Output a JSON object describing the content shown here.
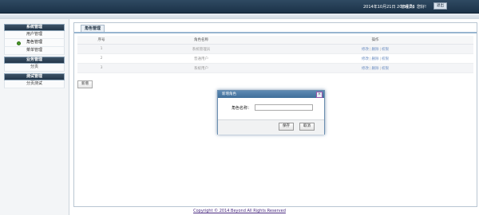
{
  "header": {
    "datetime": "2014年10月21日 20:54:28",
    "user": "管理员，您好!",
    "logout_label": "退出"
  },
  "sidebar": {
    "groups": [
      {
        "title": "系统管理",
        "items": [
          {
            "label": "用户管理"
          },
          {
            "label": "角色管理",
            "active": true
          },
          {
            "label": "菜单管理"
          }
        ]
      },
      {
        "title": "业务管理",
        "items": [
          {
            "label": "分页"
          }
        ]
      },
      {
        "title": "测试管理",
        "items": [
          {
            "label": "分页测试"
          }
        ]
      }
    ]
  },
  "main": {
    "tab": "角色管理",
    "table": {
      "headers": [
        "序号",
        "角色名称",
        "操作"
      ],
      "rows": [
        {
          "no": "1",
          "name": "系统管理员",
          "ops": [
            "修改",
            "删除",
            "权限"
          ]
        },
        {
          "no": "2",
          "name": "普通用户",
          "ops": [
            "修改",
            "删除",
            "权限"
          ]
        },
        {
          "no": "3",
          "name": "系统用户",
          "ops": [
            "修改",
            "删除",
            "权限"
          ]
        }
      ]
    },
    "add_label": "新增"
  },
  "dialog": {
    "title": "新增角色",
    "close": "×",
    "field_label": "角色名称：",
    "field_value": "",
    "save_label": "保存",
    "cancel_label": "取消"
  },
  "footer": {
    "copyright": "Copyright © 2014 Beyond All Rights Reserved"
  },
  "colors": {
    "header_bg": "#1b3248",
    "link": "#6a8cc0",
    "footer_link": "#4a2a80"
  }
}
